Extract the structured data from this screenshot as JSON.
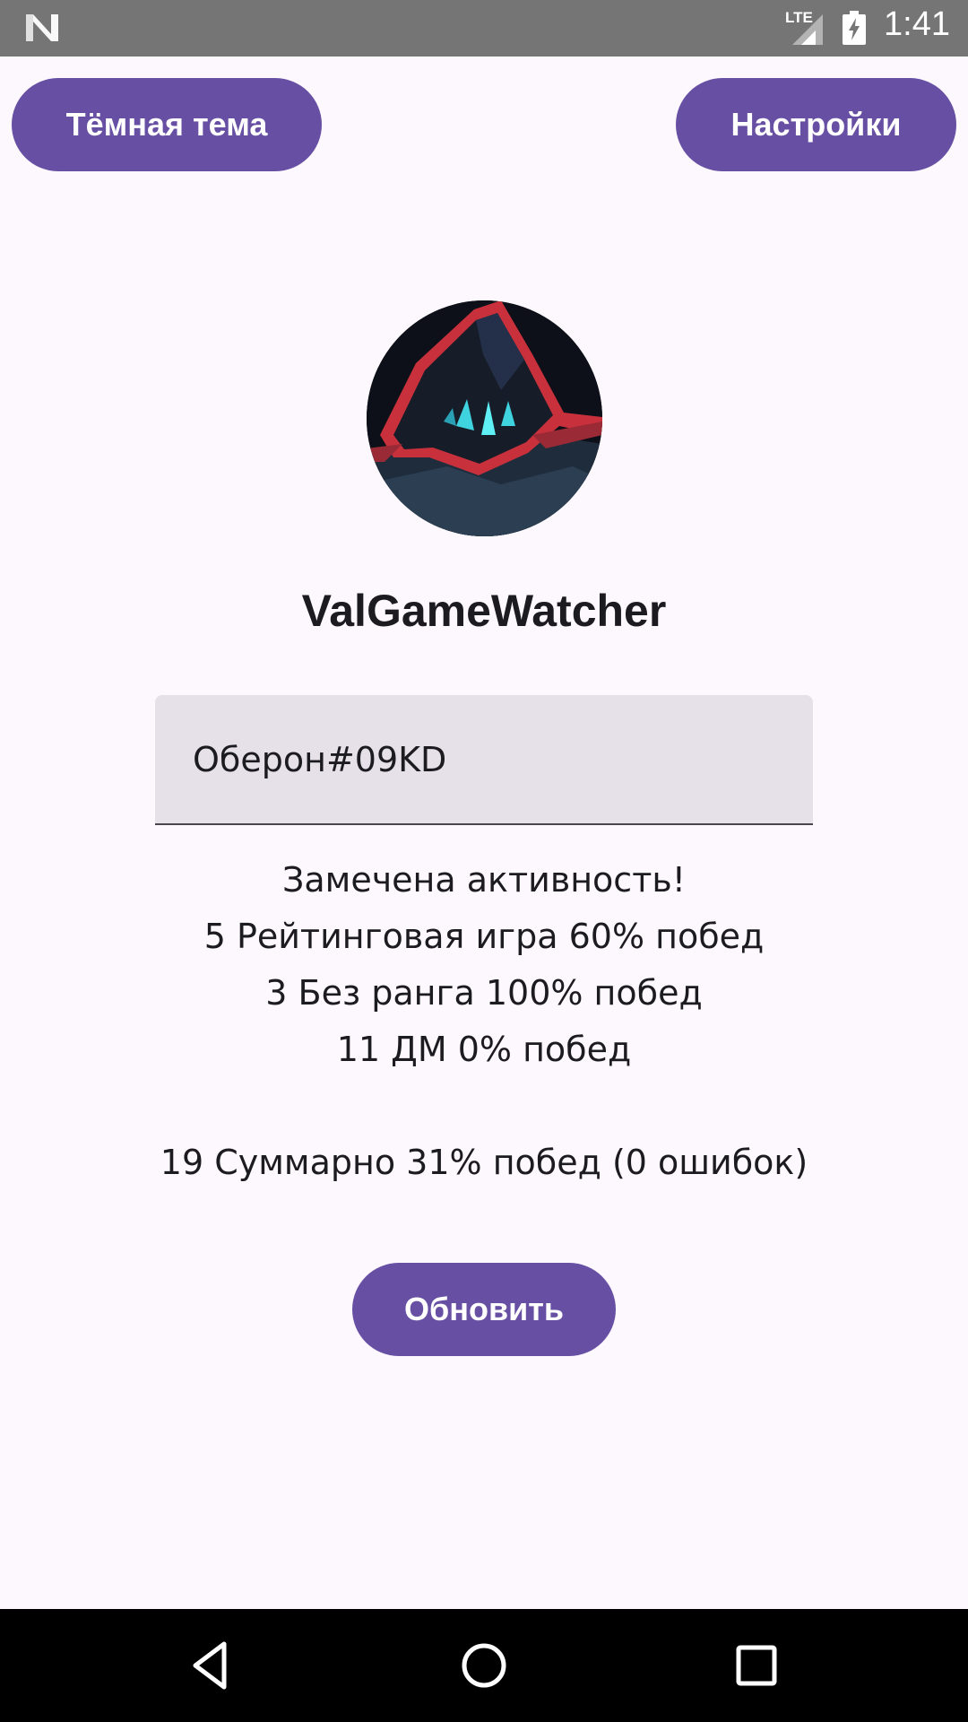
{
  "status_bar": {
    "network_label": "LTE",
    "time": "1:41",
    "icons": [
      "n-logo-icon",
      "signal-icon",
      "battery-charging-icon"
    ]
  },
  "header": {
    "dark_theme_label": "Тёмная тема",
    "settings_label": "Настройки"
  },
  "profile": {
    "avatar_icon": "hooded-figure-avatar",
    "app_title": "ValGameWatcher",
    "riot_id_value": "Оберон#09KD"
  },
  "stats": {
    "activity": "Замечена активность!",
    "ranked": "5 Рейтинговая игра 60% побед",
    "unrated": "3 Без ранга 100% побед",
    "deathmatch": "11 ДМ 0% побед",
    "total": "19 Суммарно 31% побед (0 ошибок)"
  },
  "actions": {
    "refresh_label": "Обновить"
  },
  "nav_bar": {
    "icons": [
      "back-icon",
      "home-icon",
      "recents-icon"
    ]
  },
  "colors": {
    "primary": "#6750a4",
    "background": "#fdf8fd",
    "field": "#e6e0e9",
    "status_bar": "#757575"
  }
}
